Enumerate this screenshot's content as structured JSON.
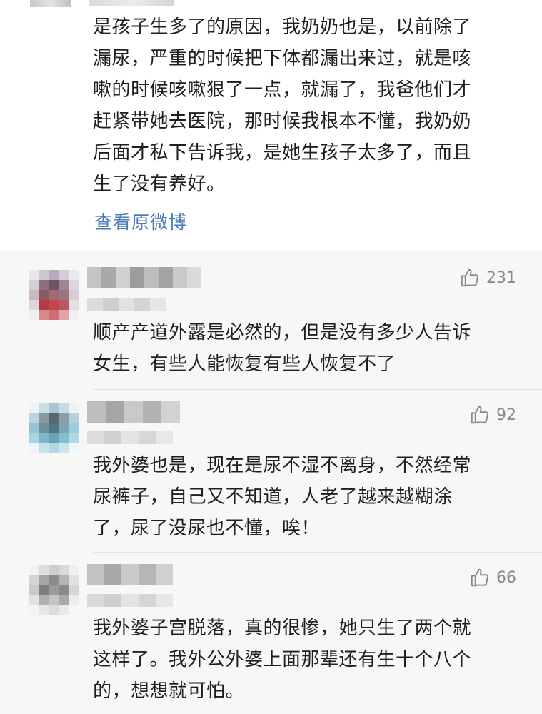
{
  "post": {
    "lines": [
      "是孩子生多了的原因，我奶奶也是，以前除了",
      "漏尿，严重的时候把下体都漏出来过，就是咳",
      "嗽的时候咳嗽狠了一点，就漏了，我爸他们才",
      "赶紧带她去医院，那时候我根本不懂，我奶奶",
      "后面才私下告诉我，是她生孩子太多了，而且",
      "生了没有养好。"
    ],
    "view_original_label": "查看原微博"
  },
  "comments": [
    {
      "likes": "231",
      "lines": [
        "顺产产道外露是必然的，但是没有多少人告诉",
        "女生，有些人能恢复有些人恢复不了"
      ]
    },
    {
      "likes": "92",
      "lines": [
        "我外婆也是，现在是尿不湿不离身，不然经常",
        "尿裤子，自己又不知道，人老了越来越糊涂",
        "了，尿了没尿也不懂，唉！"
      ]
    },
    {
      "likes": "66",
      "lines": [
        "我外婆子宫脱落，真的很惨，她只生了两个就",
        "这样了。我外公外婆上面那辈还有生十个八个",
        "的，想想就可怕。"
      ]
    }
  ],
  "colors": {
    "link": "#4a7cb5",
    "like_gray": "#8a8a8a",
    "comment_bg": "#f7f7f7"
  },
  "icons": {
    "like": "thumbs-up-icon"
  }
}
